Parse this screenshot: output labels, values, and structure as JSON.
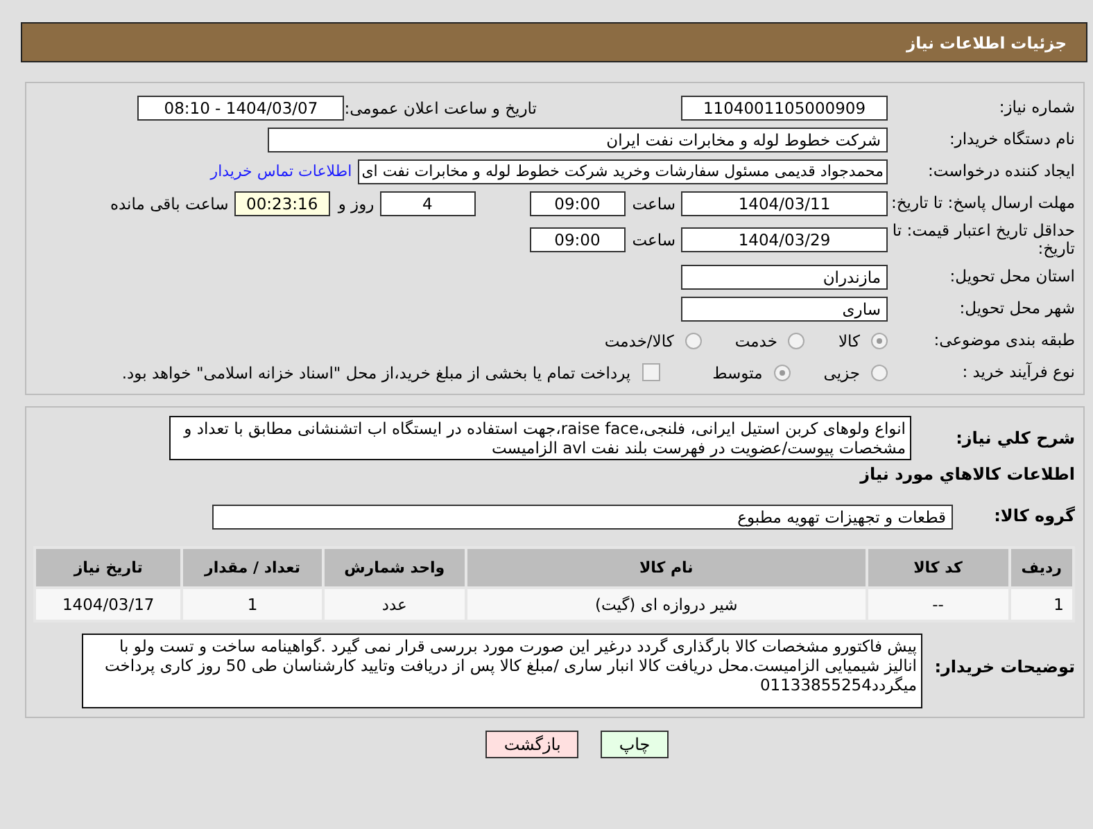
{
  "header": {
    "title": "جزئیات اطلاعات نیاز"
  },
  "need_number": {
    "label": "شماره نیاز:",
    "value": "1104001105000909"
  },
  "announce": {
    "label": "تاریخ و ساعت اعلان عمومی:",
    "value": "1404/03/07 - 08:10"
  },
  "buyer_org": {
    "label": "نام دستگاه خریدار:",
    "value": "شرکت خطوط لوله و مخابرات نفت ایران"
  },
  "requester": {
    "label": "ایجاد کننده درخواست:",
    "value": "محمدجواد قدیمی مسئول سفارشات وخرید شرکت خطوط لوله و مخابرات نفت ای",
    "link": "اطلاعات تماس خریدار"
  },
  "reply_deadline": {
    "label": "مهلت ارسال پاسخ: تا تاریخ:",
    "date": "1404/03/11",
    "time_label": "ساعت",
    "time": "09:00",
    "days": "4",
    "days_label": "روز و",
    "remaining": "00:23:16",
    "remaining_label": "ساعت باقی مانده"
  },
  "price_validity": {
    "label": "حداقل تاریخ اعتبار قیمت: تا تاریخ:",
    "date": "1404/03/29",
    "time_label": "ساعت",
    "time": "09:00"
  },
  "province": {
    "label": "استان محل تحویل:",
    "value": "مازندران"
  },
  "city": {
    "label": "شهر محل تحویل:",
    "value": "ساری"
  },
  "category": {
    "label": "طبقه بندی موضوعی:",
    "options": [
      {
        "label": "کالا",
        "selected": true
      },
      {
        "label": "خدمت",
        "selected": false
      },
      {
        "label": "کالا/خدمت",
        "selected": false
      }
    ]
  },
  "process": {
    "label": "نوع فرآیند خرید :",
    "options": [
      {
        "label": "جزیی",
        "selected": false
      },
      {
        "label": "متوسط",
        "selected": true
      }
    ],
    "payment": {
      "label": "پرداخت تمام یا بخشی از مبلغ خرید،از محل \"اسناد خزانه اسلامی\" خواهد بود.",
      "checked": false
    }
  },
  "description": {
    "label": "شرح کلي نياز:",
    "value": "انواع ولوهای کربن استیل ایرانی، فلنجی،raise face،جهت استفاده در ایستگاه اب اتشنشانی مطابق با تعداد و مشخصات پیوست/عضویت در فهرست بلند نفت avl الزامیست"
  },
  "goods": {
    "title": "اطلاعات کالاهاي مورد نياز",
    "group_label": "گروه کالا:",
    "group": "قطعات و تجهیزات تهویه مطبوع",
    "columns": [
      "ردیف",
      "کد کالا",
      "نام کالا",
      "واحد شمارش",
      "تعداد / مقدار",
      "تاریخ نیاز"
    ],
    "rows": [
      [
        "1",
        "--",
        "شیر دروازه ای (گیت)",
        "عدد",
        "1",
        "1404/03/17"
      ]
    ]
  },
  "buyer_notes": {
    "label": "توضیحات خریدار:",
    "value": "پیش فاکتورو مشخصات کالا بارگذاری گردد درغیر این صورت مورد بررسی قرار نمی گیرد .گواهینامه ساخت و تست ولو با  انالیز شیمیایی الزامیست.محل دریافت کالا انبار ساری /مبلغ کالا پس از دریافت وتایید کارشناسان طی 50 روز کاری پرداخت میگردد01133855254"
  },
  "buttons": [
    {
      "label": "چاپ",
      "kind": "print"
    },
    {
      "label": "بازگشت",
      "kind": "back"
    }
  ]
}
